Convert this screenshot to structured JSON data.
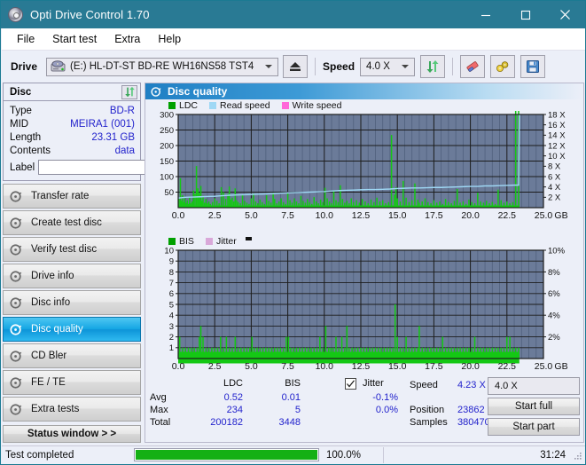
{
  "window": {
    "title": "Opti Drive Control 1.70",
    "icon": "disc-icon",
    "minimize": "minimize",
    "maximize": "maximize",
    "close": "close"
  },
  "menu": {
    "items": [
      {
        "label": "File"
      },
      {
        "label": "Start test"
      },
      {
        "label": "Extra"
      },
      {
        "label": "Help"
      }
    ]
  },
  "toolbar": {
    "drive_label": "Drive",
    "drive_value": "(E:)  HL-DT-ST BD-RE  WH16NS58 TST4",
    "eject_icon": "eject-icon",
    "speed_label": "Speed",
    "speed_value": "4.0 X",
    "refresh_icon": "refresh-icon",
    "erase_icon": "eraser-icon",
    "settings_icon": "tools-icon",
    "save_icon": "save-icon"
  },
  "sidebar": {
    "disc": {
      "title": "Disc",
      "refresh_icon": "refresh-icon",
      "rows": [
        {
          "key": "Type",
          "value": "BD-R"
        },
        {
          "key": "MID",
          "value": "MEIRA1 (001)"
        },
        {
          "key": "Length",
          "value": "23.31 GB"
        },
        {
          "key": "Contents",
          "value": "data"
        }
      ],
      "label_key": "Label",
      "label_value": "",
      "label_placeholder": "",
      "label_button_icon": "disc-icon"
    },
    "nav": [
      {
        "label": "Transfer rate",
        "icon": "disc-test-icon",
        "active": false
      },
      {
        "label": "Create test disc",
        "icon": "disc-test-icon",
        "active": false
      },
      {
        "label": "Verify test disc",
        "icon": "disc-test-icon",
        "active": false
      },
      {
        "label": "Drive info",
        "icon": "disc-test-icon",
        "active": false
      },
      {
        "label": "Disc info",
        "icon": "disc-test-icon",
        "active": false
      },
      {
        "label": "Disc quality",
        "icon": "disc-test-icon",
        "active": true
      },
      {
        "label": "CD Bler",
        "icon": "disc-test-icon",
        "active": false
      },
      {
        "label": "FE / TE",
        "icon": "disc-test-icon",
        "active": false
      },
      {
        "label": "Extra tests",
        "icon": "disc-test-icon",
        "active": false
      }
    ],
    "status_window_button": "Status window > >"
  },
  "panel": {
    "title": "Disc quality",
    "icon": "disc-quality-icon"
  },
  "stats": {
    "col_headers": [
      "LDC",
      "BIS"
    ],
    "row_labels": [
      "Avg",
      "Max",
      "Total"
    ],
    "ldc": {
      "avg": "0.52",
      "max": "234",
      "total": "200182"
    },
    "bis": {
      "avg": "0.01",
      "max": "5",
      "total": "3448"
    },
    "jitter": {
      "label": "Jitter",
      "checked": true,
      "avg": "-0.1%",
      "max": "0.0%"
    },
    "speed_label": "Speed",
    "speed_value": "4.23 X",
    "position_label": "Position",
    "position_value": "23862 MB",
    "samples_label": "Samples",
    "samples_value": "380470",
    "speed_select": "4.0 X",
    "start_full_button": "Start full",
    "start_part_button": "Start part"
  },
  "statusbar": {
    "text": "Test completed",
    "percent_label": "100.0%",
    "percent_value": 100,
    "elapsed": "31:24"
  },
  "colors": {
    "titlebar": "#297a94",
    "accent_blue": "#1f7fc4",
    "plot_bg": "#6b7b99",
    "ldc_green": "#14c814",
    "read_speed": "#9fd8f5",
    "write_speed": "#ff66d9",
    "jitter_pink": "#d9a8d9",
    "value_text": "#2222cc",
    "progress_green": "#14b014"
  },
  "chart_data": [
    {
      "type": "line",
      "name": "disc-quality-ldc-chart",
      "title": "",
      "xlabel": "GB",
      "ylabel": "",
      "xlim": [
        0.0,
        25.0
      ],
      "xticks": [
        "0.0",
        "2.5",
        "5.0",
        "7.5",
        "10.0",
        "12.5",
        "15.0",
        "17.5",
        "20.0",
        "22.5",
        "25.0"
      ],
      "ylim": [
        0,
        300
      ],
      "yticks": [
        "50",
        "100",
        "150",
        "200",
        "250",
        "300"
      ],
      "y2lim": [
        0,
        18
      ],
      "y2ticks": [
        "2 X",
        "4 X",
        "6 X",
        "8 X",
        "10 X",
        "12 X",
        "14 X",
        "16 X",
        "18 X"
      ],
      "grid": true,
      "legend": [
        {
          "label": "LDC",
          "color": "#00a000"
        },
        {
          "label": "Read speed",
          "color": "#9fd8f5"
        },
        {
          "label": "Write speed",
          "color": "#ff66d9"
        }
      ],
      "series": [
        {
          "name": "LDC",
          "kind": "impulse",
          "color": "#14c814",
          "x": [
            0.05,
            0.15,
            0.22,
            0.3,
            0.38,
            0.45,
            0.55,
            0.62,
            0.7,
            0.78,
            0.85,
            0.95,
            1.05,
            1.15,
            1.25,
            1.35,
            1.45,
            1.5,
            1.55,
            1.62,
            1.7,
            1.8,
            1.9,
            2.0,
            2.1,
            2.2,
            2.35,
            2.5,
            2.65,
            2.8,
            2.95,
            3.1,
            3.25,
            3.4,
            3.5,
            3.6,
            3.7,
            3.8,
            3.9,
            4.0,
            4.1,
            4.25,
            4.4,
            4.55,
            4.7,
            4.85,
            5.0,
            5.15,
            5.3,
            5.45,
            5.6,
            5.75,
            5.9,
            6.05,
            6.2,
            6.35,
            6.5,
            6.6,
            6.75,
            6.9,
            7.05,
            7.2,
            7.35,
            7.5,
            7.65,
            7.8,
            7.95,
            8.1,
            8.25,
            8.4,
            8.55,
            8.7,
            8.85,
            9.0,
            9.15,
            9.3,
            9.45,
            9.6,
            9.75,
            9.9,
            10.05,
            10.2,
            10.35,
            10.5,
            10.65,
            10.8,
            10.95,
            11.1,
            11.25,
            11.4,
            11.55,
            11.7,
            11.85,
            12.0,
            12.2,
            12.4,
            12.6,
            12.8,
            13.0,
            13.2,
            13.4,
            13.6,
            13.8,
            14.0,
            14.2,
            14.4,
            14.6,
            14.8,
            14.9,
            15.0,
            15.2,
            15.4,
            15.6,
            15.8,
            16.0,
            16.2,
            16.4,
            16.5,
            16.7,
            16.9,
            17.1,
            17.3,
            17.5,
            17.7,
            17.9,
            18.1,
            18.3,
            18.5,
            18.7,
            18.9,
            19.1,
            19.3,
            19.5,
            19.7,
            19.9,
            20.1,
            20.3,
            20.5,
            20.7,
            20.9,
            21.1,
            21.3,
            21.5,
            21.7,
            21.9,
            22.1,
            22.3,
            22.5,
            22.7,
            22.9,
            23.1,
            23.3
          ],
          "y": [
            28,
            95,
            22,
            40,
            18,
            30,
            15,
            24,
            12,
            35,
            14,
            20,
            55,
            45,
            134,
            62,
            48,
            30,
            70,
            22,
            38,
            16,
            28,
            14,
            20,
            12,
            18,
            30,
            22,
            14,
            66,
            50,
            28,
            44,
            68,
            26,
            32,
            20,
            62,
            24,
            18,
            14,
            40,
            22,
            16,
            12,
            30,
            46,
            20,
            14,
            26,
            18,
            12,
            40,
            22,
            16,
            48,
            28,
            14,
            20,
            30,
            18,
            12,
            46,
            24,
            16,
            30,
            20,
            14,
            38,
            22,
            16,
            28,
            18,
            12,
            34,
            20,
            14,
            26,
            18,
            64,
            30,
            20,
            14,
            56,
            24,
            18,
            72,
            28,
            16,
            22,
            14,
            30,
            18,
            24,
            16,
            28,
            20,
            14,
            26,
            18,
            32,
            20,
            24,
            14,
            18,
            234,
            42,
            66,
            30,
            20,
            86,
            32,
            18,
            24,
            78,
            26,
            16,
            20,
            30,
            18,
            14,
            24,
            16,
            20,
            12,
            28,
            18,
            14,
            22,
            60,
            16,
            20,
            12,
            26,
            18,
            14,
            48,
            20,
            16,
            22,
            14,
            18,
            12,
            58,
            24,
            16,
            20,
            14,
            18
          ]
        },
        {
          "name": "Read speed",
          "kind": "line",
          "color": "#9fd8f5",
          "axis": "y2",
          "x": [
            0.0,
            0.5,
            1.0,
            1.5,
            2.0,
            2.5,
            3.0,
            3.5,
            4.0,
            4.5,
            5.0,
            5.5,
            6.0,
            6.5,
            7.0,
            7.5,
            8.0,
            8.5,
            9.0,
            9.5,
            10.0,
            10.5,
            11.0,
            11.5,
            12.0,
            12.5,
            13.0,
            13.5,
            14.0,
            14.5,
            15.0,
            15.5,
            16.0,
            16.5,
            17.0,
            17.5,
            18.0,
            18.5,
            19.0,
            19.5,
            20.0,
            20.5,
            21.0,
            21.5,
            22.0,
            22.5,
            23.0,
            23.3,
            23.35
          ],
          "y": [
            1.85,
            2.0,
            2.05,
            2.1,
            2.15,
            2.2,
            2.3,
            2.4,
            2.45,
            2.5,
            2.55,
            2.6,
            2.65,
            2.7,
            2.8,
            2.85,
            2.9,
            2.95,
            3.0,
            3.05,
            3.1,
            3.2,
            3.3,
            3.35,
            3.4,
            3.45,
            3.5,
            3.5,
            3.55,
            3.6,
            3.7,
            3.75,
            3.8,
            3.8,
            3.85,
            3.9,
            3.9,
            3.95,
            4.0,
            4.05,
            4.1,
            4.1,
            4.2,
            4.2,
            4.25,
            4.3,
            4.35,
            4.35,
            18.0
          ]
        }
      ]
    },
    {
      "type": "line",
      "name": "disc-quality-bis-chart",
      "title": "",
      "xlabel": "GB",
      "ylabel": "",
      "xlim": [
        0.0,
        25.0
      ],
      "xticks": [
        "0.0",
        "2.5",
        "5.0",
        "7.5",
        "10.0",
        "12.5",
        "15.0",
        "17.5",
        "20.0",
        "22.5",
        "25.0"
      ],
      "ylim": [
        0,
        10
      ],
      "yticks": [
        "1",
        "2",
        "3",
        "4",
        "5",
        "6",
        "7",
        "8",
        "9",
        "10"
      ],
      "y2lim": [
        0,
        10
      ],
      "y2ticks": [
        "2%",
        "4%",
        "6%",
        "8%",
        "10%"
      ],
      "grid": true,
      "legend": [
        {
          "label": "BIS",
          "color": "#00a000"
        },
        {
          "label": "Jitter",
          "color": "#d9a8d9"
        }
      ],
      "series": [
        {
          "name": "BIS",
          "kind": "impulse",
          "color": "#14c814",
          "x": [
            0.1,
            0.3,
            0.5,
            0.7,
            0.9,
            1.1,
            1.3,
            1.45,
            1.55,
            1.7,
            1.9,
            2.1,
            2.3,
            2.5,
            2.7,
            2.9,
            3.1,
            3.3,
            3.5,
            3.7,
            3.9,
            4.1,
            4.3,
            4.5,
            4.7,
            4.9,
            5.05,
            5.2,
            5.4,
            5.6,
            5.8,
            6.0,
            6.2,
            6.4,
            6.6,
            6.8,
            7.0,
            7.2,
            7.4,
            7.55,
            7.7,
            7.9,
            8.1,
            8.3,
            8.5,
            8.7,
            8.9,
            9.1,
            9.3,
            9.5,
            9.7,
            9.9,
            10.1,
            10.3,
            10.45,
            10.6,
            10.8,
            11.0,
            11.2,
            11.4,
            11.55,
            11.7,
            11.9,
            12.1,
            12.3,
            12.5,
            12.7,
            12.9,
            13.1,
            13.3,
            13.5,
            13.7,
            13.9,
            14.1,
            14.3,
            14.5,
            14.7,
            14.85,
            15.0,
            15.2,
            15.4,
            15.6,
            15.8,
            16.0,
            16.2,
            16.4,
            16.5,
            16.7,
            16.9,
            17.1,
            17.3,
            17.5,
            17.7,
            17.9,
            18.1,
            18.3,
            18.5,
            18.7,
            18.9,
            19.1,
            19.3,
            19.5,
            19.7,
            19.9,
            20.1,
            20.3,
            20.5,
            20.7,
            20.9,
            21.1,
            21.3,
            21.5,
            21.7,
            21.9,
            22.1,
            22.3,
            22.5,
            22.7,
            22.9,
            23.1,
            23.3
          ],
          "y": [
            2,
            1,
            1,
            1,
            1,
            1,
            1,
            2,
            3,
            2,
            1,
            1,
            1,
            1,
            1,
            2,
            1,
            2,
            1,
            1,
            2,
            1,
            1,
            1,
            1,
            1,
            2,
            1,
            1,
            1,
            1,
            1,
            1,
            1,
            1,
            1,
            1,
            1,
            2,
            2,
            1,
            1,
            1,
            1,
            1,
            1,
            1,
            1,
            1,
            1,
            2,
            1,
            3,
            1,
            1,
            1,
            2,
            1,
            2,
            1,
            3,
            1,
            1,
            1,
            1,
            1,
            1,
            1,
            1,
            1,
            1,
            1,
            1,
            1,
            1,
            1,
            1,
            5,
            2,
            1,
            1,
            2,
            1,
            1,
            1,
            1,
            3,
            1,
            1,
            1,
            1,
            1,
            1,
            1,
            2,
            1,
            1,
            1,
            1,
            1,
            1,
            1,
            1,
            1,
            1,
            2,
            1,
            1,
            1,
            1,
            1,
            1,
            1,
            1,
            1,
            1,
            2,
            2,
            1,
            1,
            1
          ]
        },
        {
          "name": "Jitter",
          "kind": "line",
          "color": "#d9a8d9",
          "axis": "y2",
          "x": [],
          "y": []
        }
      ]
    }
  ]
}
